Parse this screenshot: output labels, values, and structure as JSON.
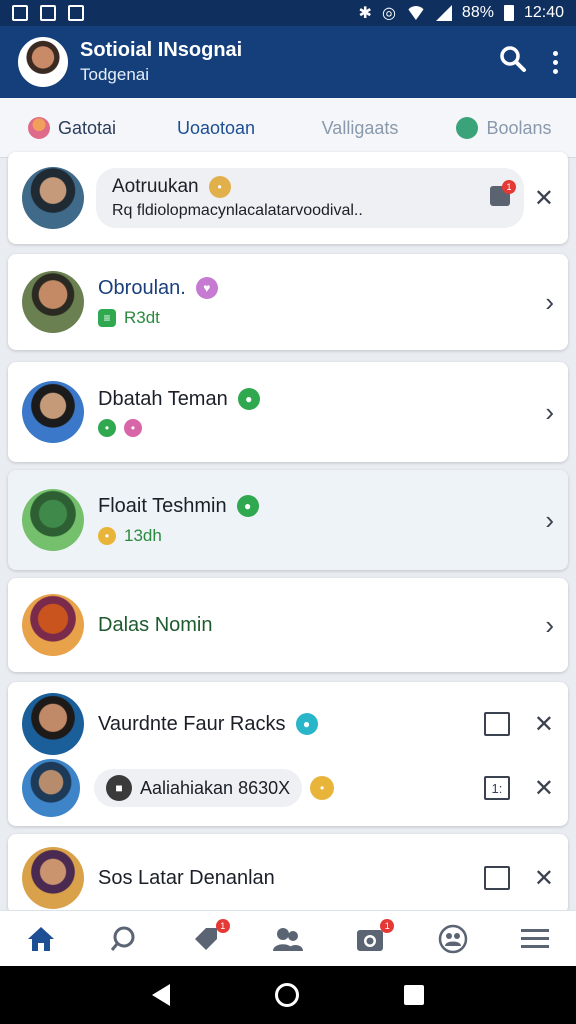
{
  "status_bar": {
    "battery": "88%",
    "time": "12:40"
  },
  "app_bar": {
    "title": "Sotioial INsognai",
    "subtitle": "Todgenai"
  },
  "tabs": [
    {
      "label": "Gatotai"
    },
    {
      "label": "Uoaotoan"
    },
    {
      "label": "Valligaats"
    },
    {
      "label": "Boolans"
    }
  ],
  "items": [
    {
      "name": "Aotruukan",
      "message": "Rq fldiolopmacynlacalatarvoodival..",
      "badge": "1"
    },
    {
      "name": "Obroulan.",
      "meta": "R3dt"
    },
    {
      "name": "Dbatah Teman"
    },
    {
      "name": "Floait Teshmin",
      "meta": "13dh"
    },
    {
      "name": "Dalas Nomin"
    },
    {
      "name": "Vaurdnte Faur Racks",
      "sub_name": "Aaliahiakan 8630X",
      "square_label": "1:"
    },
    {
      "name": "Sos Latar Denanlan"
    }
  ],
  "bottom_nav": {
    "notif_badge": "1",
    "camera_badge": "1"
  }
}
